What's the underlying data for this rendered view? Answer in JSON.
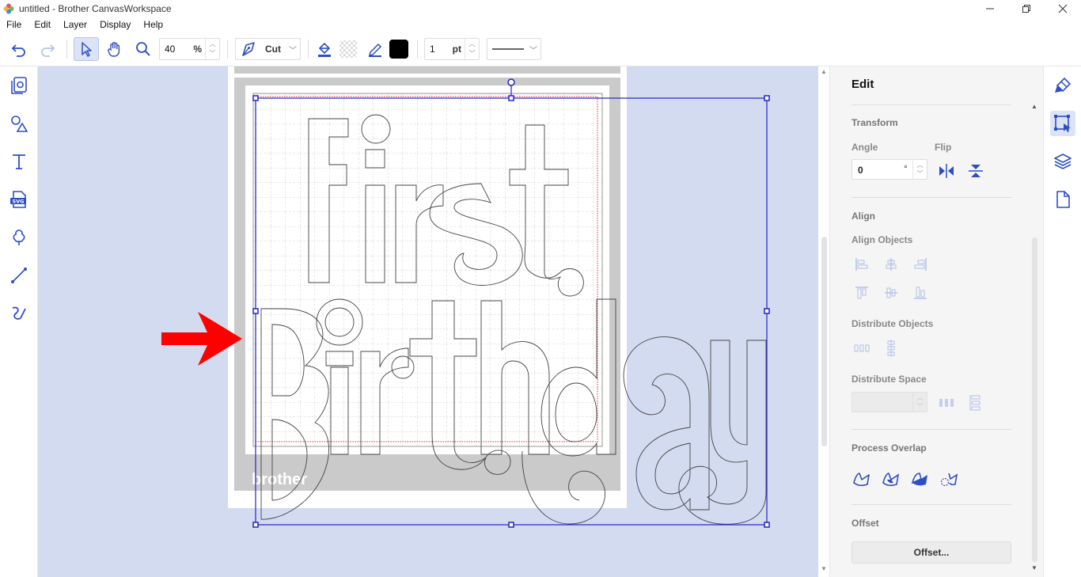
{
  "window": {
    "title": "untitled - Brother CanvasWorkspace"
  },
  "menu": [
    "File",
    "Edit",
    "Layer",
    "Display",
    "Help"
  ],
  "toolbar": {
    "zoom_value": "40",
    "zoom_unit": "%",
    "mode_label": "Cut",
    "line_width_value": "1",
    "line_width_unit": "pt",
    "line_color": "#000000"
  },
  "canvas": {
    "mat_logo": "brother"
  },
  "panel": {
    "title": "Edit",
    "transform": {
      "heading": "Transform",
      "angle_label": "Angle",
      "angle_value": "0",
      "angle_unit": "°",
      "flip_label": "Flip"
    },
    "align": {
      "heading": "Align",
      "align_objects_label": "Align Objects",
      "distribute_objects_label": "Distribute Objects",
      "distribute_space_label": "Distribute Space",
      "distribute_space_value": ""
    },
    "process_overlap": {
      "heading": "Process Overlap"
    },
    "offset": {
      "heading": "Offset",
      "button_label": "Offset..."
    }
  },
  "colors": {
    "accent": "#2e4fc4",
    "canvas_bg": "#d3dbf1",
    "annotation_arrow": "#ff0000",
    "selection": "#2323c8"
  }
}
